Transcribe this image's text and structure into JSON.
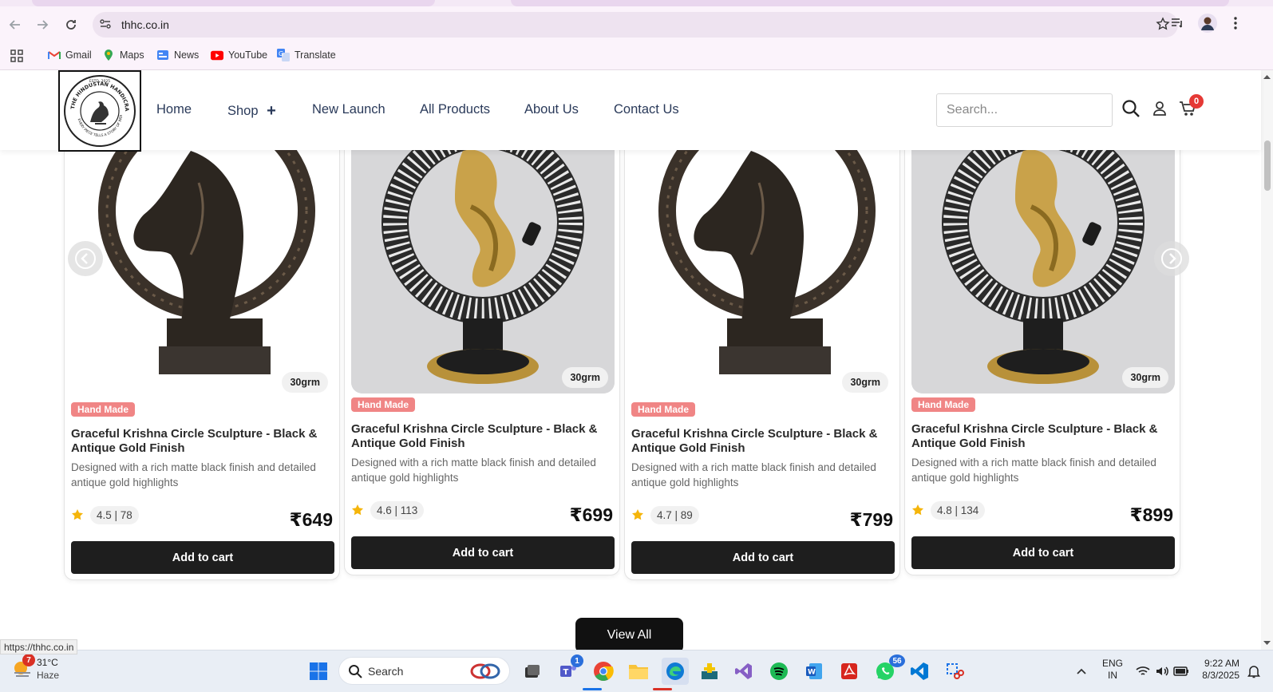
{
  "browser": {
    "url": "thhc.co.in",
    "bookmarks": [
      {
        "label": "Gmail",
        "icon": "gmail-icon"
      },
      {
        "label": "Maps",
        "icon": "maps-icon"
      },
      {
        "label": "News",
        "icon": "news-icon"
      },
      {
        "label": "YouTube",
        "icon": "youtube-icon"
      },
      {
        "label": "Translate",
        "icon": "translate-icon"
      }
    ],
    "status_url": "https://thhc.co.in"
  },
  "site": {
    "nav": [
      "Home",
      "Shop",
      "New Launch",
      "All Products",
      "About Us",
      "Contact Us"
    ],
    "search_placeholder": "Search...",
    "cart_count": "0",
    "logo_top_text": "THE HINDUSTAN HANDICRAFT COMPANY",
    "logo_bottom_text": "EVERY PIECE TELLS A STORY OF INDIA",
    "logo_est": "ESTD. 2025"
  },
  "products": [
    {
      "image": "horse-sculpture",
      "weight": "30grm",
      "badge": "Hand Made",
      "name": "Graceful Krishna Circle Sculpture - Black & Antique Gold Finish",
      "desc": "Designed with a rich matte black finish and detailed antique gold highlights",
      "rating": "4.5 | 78",
      "price": "₹649",
      "cta": "Add to cart"
    },
    {
      "image": "krishna-ring-sculpture",
      "weight": "30grm",
      "badge": "Hand Made",
      "name": "Graceful Krishna Circle Sculpture - Black & Antique Gold Finish",
      "desc": "Designed with a rich matte black finish and detailed antique gold highlights",
      "rating": "4.6 | 113",
      "price": "₹699",
      "cta": "Add to cart"
    },
    {
      "image": "horse-sculpture",
      "weight": "30grm",
      "badge": "Hand Made",
      "name": "Graceful Krishna Circle Sculpture - Black & Antique Gold Finish",
      "desc": "Designed with a rich matte black finish and detailed antique gold highlights",
      "rating": "4.7 | 89",
      "price": "₹799",
      "cta": "Add to cart"
    },
    {
      "image": "krishna-ring-sculpture",
      "weight": "30grm",
      "badge": "Hand Made",
      "name": "Graceful Krishna Circle Sculpture - Black & Antique Gold Finish",
      "desc": "Designed with a rich matte black finish and detailed antique gold highlights",
      "rating": "4.8 | 134",
      "price": "₹899",
      "cta": "Add to cart"
    }
  ],
  "view_all": "View All",
  "colors": {
    "badge": "#f08585",
    "button": "#1e1e1e",
    "star": "#f5b50a",
    "cart_badge": "#e53935"
  },
  "taskbar": {
    "weather_temp": "31°C",
    "weather_desc": "Haze",
    "weather_badge": "7",
    "search_label": "Search",
    "teams_badge": "1",
    "whatsapp_badge": "56",
    "lang_top": "ENG",
    "lang_bottom": "IN",
    "time": "9:22 AM",
    "date": "8/3/2025"
  }
}
